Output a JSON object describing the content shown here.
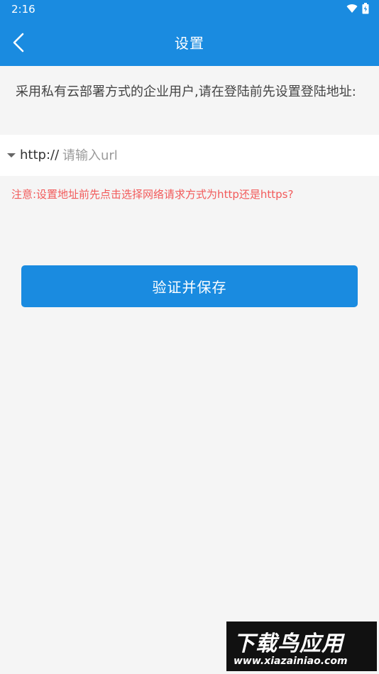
{
  "status_bar": {
    "time": "2:16"
  },
  "app_bar": {
    "title": "设置"
  },
  "intro_text": "采用私有云部署方式的企业用户,请在登陆前先设置登陆地址:",
  "url_field": {
    "protocol": "http://",
    "value": "",
    "placeholder": "请输入url"
  },
  "notice_text": "注意:设置地址前先点击选择网络请求方式为http还是https?",
  "save_button_label": "验证并保存",
  "watermark": {
    "title": "下载鸟应用",
    "url": "www.xiazainiao.com"
  },
  "colors": {
    "primary": "#1a8be0",
    "notice": "#f25a5a",
    "background": "#f5f5f5"
  },
  "icons": {
    "back": "chevron-left-icon",
    "wifi": "wifi-icon",
    "battery": "battery-icon",
    "dropdown": "caret-down-icon"
  }
}
